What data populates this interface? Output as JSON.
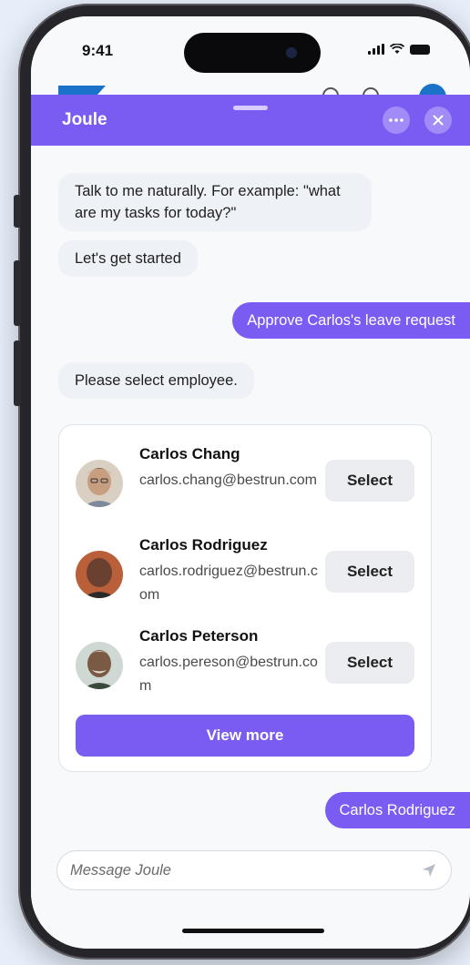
{
  "status_bar": {
    "time": "9:41"
  },
  "header": {
    "title": "Joule",
    "more_icon": "more-horizontal-icon",
    "close_icon": "close-icon"
  },
  "messages": [
    {
      "role": "bot",
      "text": "Talk to me naturally. For example: \"what are my tasks for today?\""
    },
    {
      "role": "bot",
      "text": "Let's get started"
    },
    {
      "role": "user",
      "text": "Approve Carlos's leave request"
    },
    {
      "role": "bot",
      "text": "Please select employee."
    }
  ],
  "employees": [
    {
      "name": "Carlos Chang",
      "email": "carlos.chang@bestrun.com",
      "action": "Select"
    },
    {
      "name": "Carlos Rodriguez",
      "email": "carlos.rodriguez@bestrun.com",
      "action": "Select"
    },
    {
      "name": "Carlos Peterson",
      "email": "carlos.pereson@bestrun.com",
      "action": "Select"
    }
  ],
  "view_more_label": "View more",
  "user_reply": "Carlos Rodriguez",
  "input": {
    "placeholder": "Message Joule",
    "value": ""
  },
  "colors": {
    "accent": "#7b5cf2",
    "bot_bubble": "#eef1f5",
    "background": "#e6eefa"
  }
}
